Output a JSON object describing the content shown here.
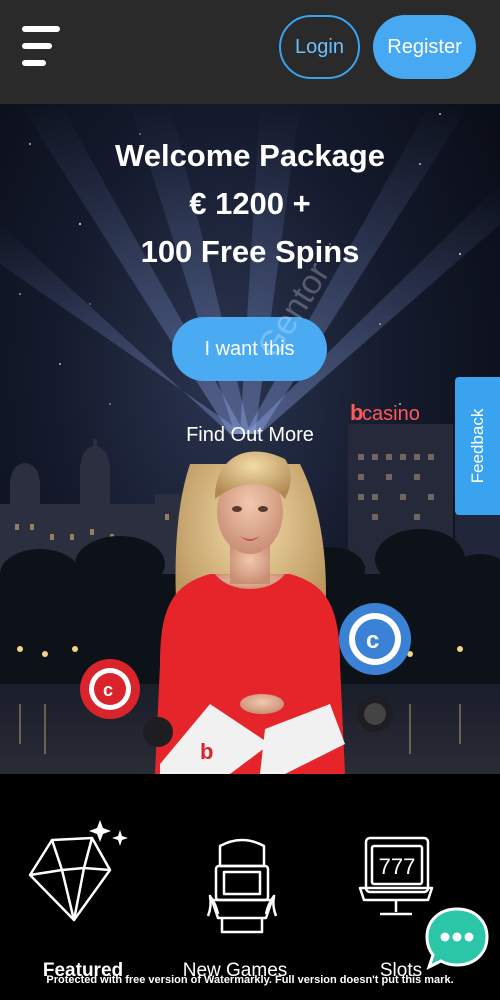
{
  "header": {
    "login_label": "Login",
    "register_label": "Register",
    "accent": "#47a9f2",
    "background": "#2a2a2a"
  },
  "hero": {
    "title_lines": [
      "Welcome Package",
      "€ 1200 +",
      "100 Free Spins"
    ],
    "cta_label": "I want this",
    "find_out_label": "Find Out More",
    "sign_text": "casino",
    "watermark_text": "Gentor"
  },
  "feedback": {
    "label": "Feedback"
  },
  "nav": {
    "items": [
      {
        "label": "Featured",
        "icon": "diamond-icon",
        "active": true
      },
      {
        "label": "New Games",
        "icon": "arcade-machine-icon",
        "active": false
      },
      {
        "label": "Slots",
        "icon": "slot-machine-777-icon",
        "active": false
      }
    ],
    "slot_digits": "777"
  },
  "chat": {
    "icon": "chat-bubble-icon",
    "color": "#2bc5a8"
  },
  "footer": {
    "notice": "Protected with free version of Watermarkly. Full version doesn't put this mark."
  }
}
